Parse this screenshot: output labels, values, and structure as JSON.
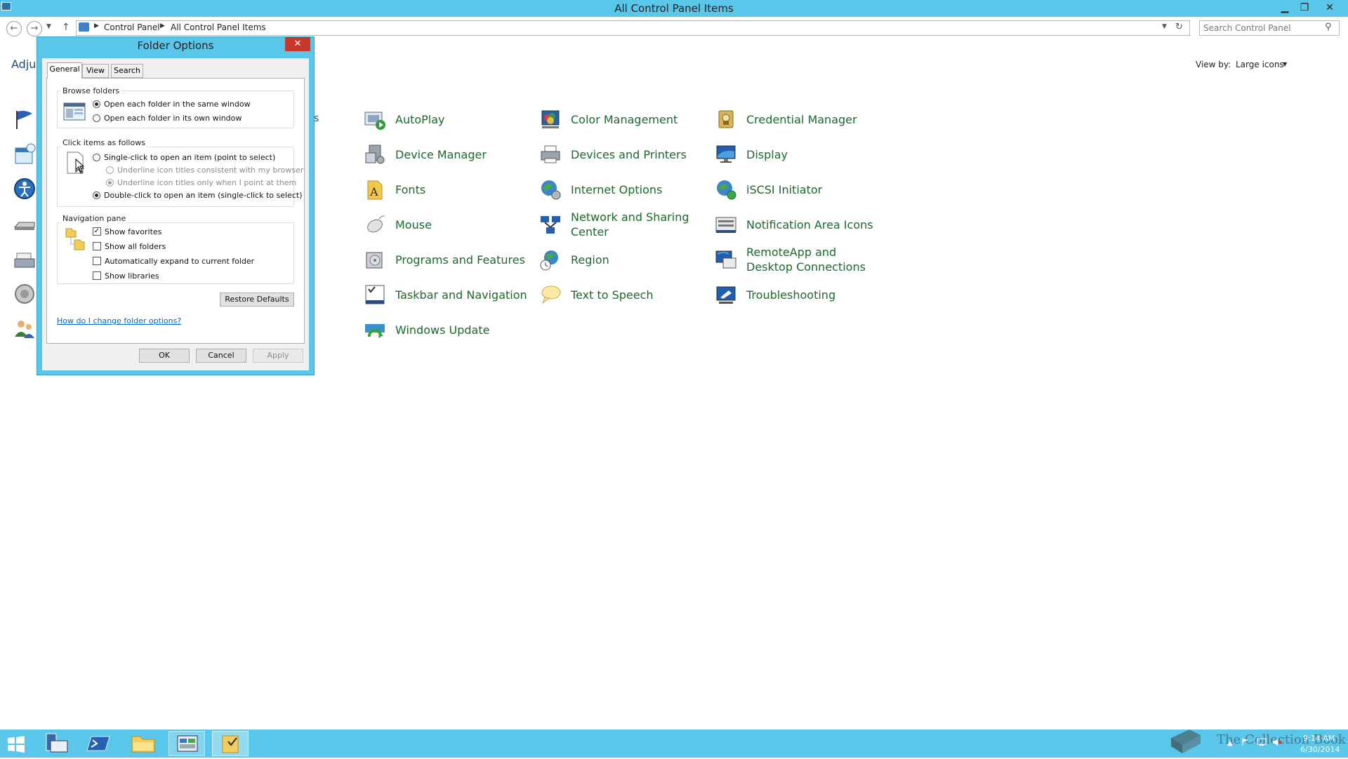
{
  "window": {
    "title": "All Control Panel Items",
    "minimize": "▁",
    "restore": "❐",
    "close": "✕"
  },
  "address": {
    "crumbs": [
      "Control Panel",
      "All Control Panel Items"
    ],
    "search_placeholder": "Search Control Panel"
  },
  "main": {
    "partial_heading": "Adju",
    "view_by_label": "View by:",
    "view_by_value": "Large icons",
    "items": [
      {
        "label": "AutoPlay"
      },
      {
        "label": "Color Management"
      },
      {
        "label": "Credential Manager"
      },
      {
        "label": "Device Manager"
      },
      {
        "label": "Devices and Printers"
      },
      {
        "label": "Display"
      },
      {
        "label": "Fonts"
      },
      {
        "label": "Internet Options"
      },
      {
        "label": "iSCSI Initiator"
      },
      {
        "label": "Mouse"
      },
      {
        "label": "Network and Sharing Center"
      },
      {
        "label": "Notification Area Icons"
      },
      {
        "label": "Programs and Features"
      },
      {
        "label": "Region"
      },
      {
        "label": "RemoteApp and Desktop Connections"
      },
      {
        "label": "Taskbar and Navigation"
      },
      {
        "label": "Text to Speech"
      },
      {
        "label": "Troubleshooting"
      },
      {
        "label": "Windows Update"
      }
    ]
  },
  "dialog": {
    "title": "Folder Options",
    "close": "✕",
    "tabs": [
      "General",
      "View",
      "Search"
    ],
    "browse_group": "Browse folders",
    "browse_same": "Open each folder in the same window",
    "browse_own": "Open each folder in its own window",
    "click_group": "Click items as follows",
    "single_click": "Single-click to open an item (point to select)",
    "underline_browser": "Underline icon titles consistent with my browser",
    "underline_point": "Underline icon titles only when I point at them",
    "double_click": "Double-click to open an item (single-click to select)",
    "nav_group": "Navigation pane",
    "show_favorites": "Show favorites",
    "show_all_folders": "Show all folders",
    "auto_expand": "Automatically expand to current folder",
    "show_libraries": "Show libraries",
    "restore_defaults": "Restore Defaults",
    "help_link": "How do I change folder options?",
    "ok": "OK",
    "cancel": "Cancel",
    "apply": "Apply"
  },
  "taskbar": {
    "time": "9:14 AM",
    "date": "6/30/2014",
    "watermark": "The Collection Book"
  }
}
